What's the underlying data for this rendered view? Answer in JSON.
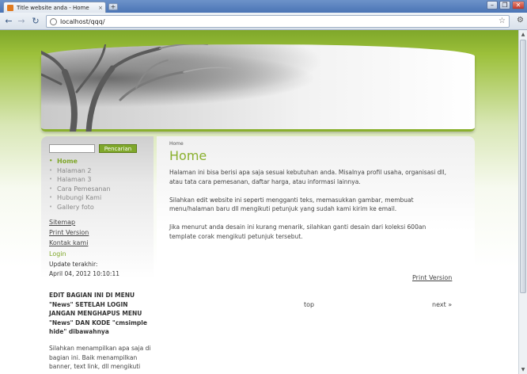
{
  "browser": {
    "tab_title": "Title website anda - Home",
    "tab_close": "×",
    "new_tab": "+",
    "url": "localhost/qqq/",
    "minimize": "–",
    "restore": "❐",
    "close": "✕",
    "back": "←",
    "forward": "→",
    "reload": "↻",
    "star": "☆",
    "wrench": "🔧"
  },
  "site": {
    "search_button": "Pencarian",
    "menu": [
      {
        "label": "Home",
        "active": true
      },
      {
        "label": "Halaman 2",
        "active": false
      },
      {
        "label": "Halaman 3",
        "active": false
      },
      {
        "label": "Cara Pemesanan",
        "active": false
      },
      {
        "label": "Hubungi Kami",
        "active": false
      },
      {
        "label": "Gallery foto",
        "active": false
      }
    ],
    "links": [
      "Sitemap",
      "Print Version",
      "Kontak kami"
    ],
    "login": "Login",
    "update_label": "Update terakhir:",
    "update_date": "April 04, 2012 10:10:11",
    "edit_note": "EDIT BAGIAN INI DI MENU \"News\" SETELAH LOGIN JANGAN MENGHAPUS MENU \"News\" DAN KODE \"cmsimple hide\" dibawahnya",
    "side_para": "Silahkan menampilkan apa saja di bagian ini. Baik menampilkan banner, text link, dll mengikuti",
    "breadcrumb": "Home",
    "title": "Home",
    "paragraphs": [
      "Halaman ini bisa berisi apa saja sesuai kebutuhan anda. Misalnya profil usaha, organisasi dll, atau tata cara pemesanan, daftar harga, atau informasi lainnya.",
      "Silahkan edit website ini seperti mengganti teks, memasukkan gambar, membuat menu/halaman baru dll mengikuti petunjuk yang sudah kami kirim ke email.",
      "Jika menurut anda desain ini kurang menarik, silahkan ganti desain dari koleksi 600an template corak mengikuti petunjuk tersebut."
    ],
    "print_version": "Print Version",
    "top": "top",
    "next": "next »"
  }
}
